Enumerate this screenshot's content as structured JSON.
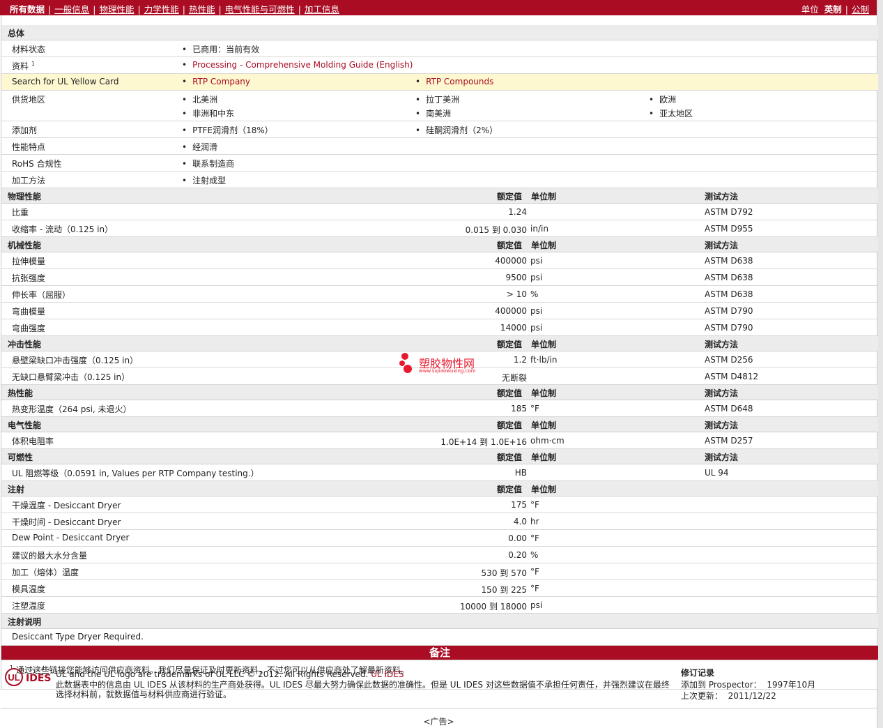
{
  "nav": {
    "items": [
      "所有数据",
      "一般信息",
      "物理性能",
      "力学性能",
      "热性能",
      "电气性能与可燃性",
      "加工信息"
    ],
    "units_label": "单位",
    "unit_imperial": "英制",
    "unit_metric": "公制"
  },
  "general": {
    "section": "总体",
    "status_label": "材料状态",
    "status_value": "已商用：当前有效",
    "docs_label": "资料",
    "docs_sup": "1",
    "docs_link": "Processing - Comprehensive Molding Guide (English)",
    "ul_label": "Search for UL Yellow Card",
    "ul_link1": "RTP Company",
    "ul_link2": "RTP Compounds",
    "region_label": "供货地区",
    "regions": [
      "北美洲",
      "拉丁美洲",
      "欧洲",
      "非洲和中东",
      "南美洲",
      "亚太地区"
    ],
    "additive_label": "添加剂",
    "additive1": "PTFE润滑剂（18%）",
    "additive2": "硅酮润滑剂（2%）",
    "feature_label": "性能特点",
    "feature_value": "经润滑",
    "rohs_label": "RoHS 合规性",
    "rohs_value": "联系制造商",
    "method_label": "加工方法",
    "method_value": "注射成型"
  },
  "headers": {
    "value": "额定值",
    "unit": "单位制",
    "test": "测试方法"
  },
  "sections": [
    {
      "title": "物理性能",
      "rows": [
        {
          "label": "比重",
          "value": "1.24",
          "unit": "",
          "test": "ASTM D792"
        },
        {
          "label": "收缩率 - 流动（0.125 in）",
          "value": "0.015 到 0.030",
          "unit": "in/in",
          "test": "ASTM D955"
        }
      ]
    },
    {
      "title": "机械性能",
      "rows": [
        {
          "label": "拉伸模量",
          "value": "400000",
          "unit": "psi",
          "test": "ASTM D638"
        },
        {
          "label": "抗张强度",
          "value": "9500",
          "unit": "psi",
          "test": "ASTM D638"
        },
        {
          "label": "伸长率（屈服）",
          "value": "> 10",
          "unit": "%",
          "test": "ASTM D638"
        },
        {
          "label": "弯曲模量",
          "value": "400000",
          "unit": "psi",
          "test": "ASTM D790"
        },
        {
          "label": "弯曲强度",
          "value": "14000",
          "unit": "psi",
          "test": "ASTM D790"
        }
      ]
    },
    {
      "title": "冲击性能",
      "rows": [
        {
          "label": "悬壁梁缺口冲击强度（0.125 in）",
          "value": "1.2",
          "unit": "ft·lb/in",
          "test": "ASTM D256"
        },
        {
          "label": "无缺口悬臂梁冲击（0.125 in）",
          "value": "无断裂",
          "unit": "",
          "test": "ASTM D4812"
        }
      ]
    },
    {
      "title": "热性能",
      "rows": [
        {
          "label": "热变形温度（264 psi, 未退火）",
          "value": "185",
          "unit": "°F",
          "test": "ASTM D648"
        }
      ]
    },
    {
      "title": "电气性能",
      "rows": [
        {
          "label": "体积电阻率",
          "value": "1.0E+14 到 1.0E+16",
          "unit": "ohm·cm",
          "test": "ASTM D257"
        }
      ]
    },
    {
      "title": "可燃性",
      "rows": [
        {
          "label": "UL 阻燃等级（0.0591 in, Values per RTP Company testing.）",
          "value": "HB",
          "unit": "",
          "test": "UL 94"
        }
      ]
    },
    {
      "title": "注射",
      "rows": [
        {
          "label": "干燥温度 - Desiccant Dryer",
          "value": "175",
          "unit": "°F",
          "test": ""
        },
        {
          "label": "干燥时间 - Desiccant Dryer",
          "value": "4.0",
          "unit": "hr",
          "test": ""
        },
        {
          "label": "Dew Point - Desiccant Dryer",
          "value": "0.00",
          "unit": "°F",
          "test": ""
        },
        {
          "label": "建议的最大水分含量",
          "value": "0.20",
          "unit": "%",
          "test": ""
        },
        {
          "label": "加工（熔体）温度",
          "value": "530 到 570",
          "unit": "°F",
          "test": ""
        },
        {
          "label": "模具温度",
          "value": "150 到 225",
          "unit": "°F",
          "test": ""
        },
        {
          "label": "注塑温度",
          "value": "10000 到 18000",
          "unit": "psi",
          "test": ""
        }
      ]
    }
  ],
  "injection_notes": {
    "title": "注射说明",
    "text": "Desiccant Type Dryer Required."
  },
  "notes": {
    "title": "备注",
    "sup": "1",
    "text": "通过这些链接您能够访问供应商资料。我们尽量保证及时更新资料，不过您可以从供应商处了解最新资料。"
  },
  "footer": {
    "logo_text": "IDES",
    "logo_powered": "Powered by",
    "line1": "UL and the UL logo are trademarks of UL LLC © 2012. All Rights Reserved.",
    "line1_link": "UL IDES",
    "line2": "此数据表中的信息由 UL IDES 从该材料的生产商处获得。UL IDES 尽最大努力确保此数据的准确性。但是 UL IDES 对这些数据值不承担任何责任，并强烈建议在最终选择材料前，就数据值与材料供应商进行验证。",
    "rev_title": "修订记录",
    "rev_added_label": "添加到 Prospector：",
    "rev_added": "1997年10月",
    "rev_updated_label": "上次更新：",
    "rev_updated": "2011/12/22"
  },
  "watermark": {
    "cn": "塑胶物性网",
    "url": "www.sujiaowuxing.com"
  },
  "ad": "<广告>",
  "colors": {
    "brand": "#a90c23",
    "highlight": "#fdf8d0",
    "section": "#ececec"
  }
}
